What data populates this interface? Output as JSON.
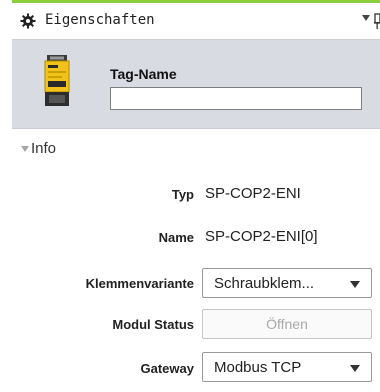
{
  "window": {
    "title": "Eigenschaften",
    "icons": {
      "title": "gear-icon",
      "menu": "dropdown-arrow-icon",
      "pin": "pin-icon"
    },
    "accent_color": "#8ccf3c"
  },
  "header": {
    "device_icon": "device-module-icon",
    "tag_label": "Tag-Name",
    "tag_value": "",
    "background": "#d9dbe2"
  },
  "section": {
    "label": "Info",
    "expanded": true
  },
  "properties": {
    "typ": {
      "label": "Typ",
      "value": "SP-COP2-ENI"
    },
    "name": {
      "label": "Name",
      "value": "SP-COP2-ENI[0]"
    },
    "klemmenvariante": {
      "label": "Klemmenvariante",
      "value": "Schraubklem..."
    },
    "modul_status": {
      "label": "Modul Status",
      "button": "Öffnen",
      "enabled": false
    },
    "gateway": {
      "label": "Gateway",
      "value": "Modbus TCP"
    }
  }
}
